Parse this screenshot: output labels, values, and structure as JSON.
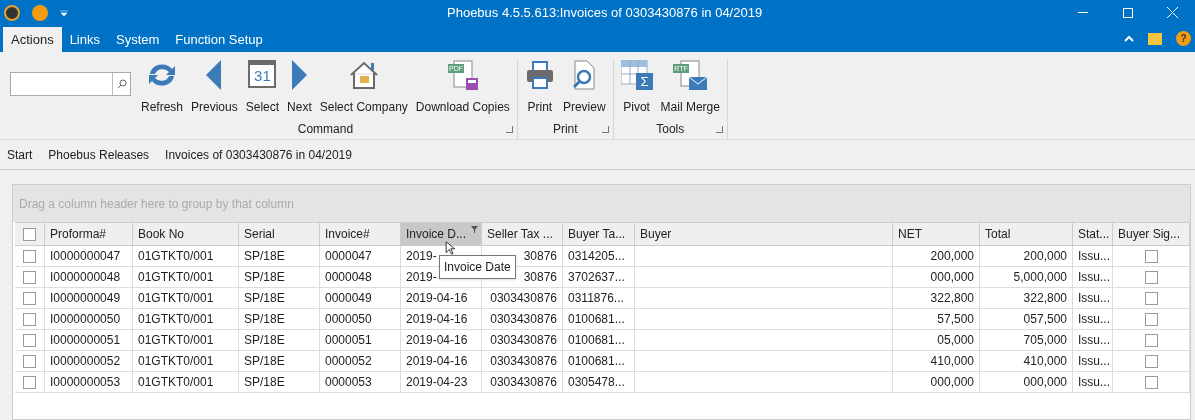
{
  "window": {
    "title": "Phoebus 4.5.5.613:Invoices of 0303430876 in 04/2019",
    "help": "?"
  },
  "menu_tabs": [
    {
      "label": "Actions",
      "selected": true
    },
    {
      "label": "Links",
      "selected": false
    },
    {
      "label": "System",
      "selected": false
    },
    {
      "label": "Function Setup",
      "selected": false
    }
  ],
  "ribbon": {
    "groups": [
      {
        "label": "Command",
        "buttons": [
          {
            "label": "Refresh",
            "kind": "refresh"
          },
          {
            "label": "Previous",
            "kind": "prev"
          },
          {
            "label": "Select",
            "kind": "calendar",
            "icon_text": "31"
          },
          {
            "label": "Next",
            "kind": "next"
          },
          {
            "label": "Select Company",
            "kind": "house"
          },
          {
            "label": "Download Copies",
            "kind": "pdf",
            "icon_text": "PDF"
          }
        ]
      },
      {
        "label": "Print",
        "buttons": [
          {
            "label": "Print",
            "kind": "printer"
          },
          {
            "label": "Preview",
            "kind": "preview"
          }
        ]
      },
      {
        "label": "Tools",
        "buttons": [
          {
            "label": "Pivot",
            "kind": "pivot",
            "icon_text": "Σ"
          },
          {
            "label": "Mail Merge",
            "kind": "rtf",
            "icon_text": "RTF"
          }
        ]
      }
    ]
  },
  "breadcrumb": [
    "Start",
    "Phoebus Releases",
    "Invoices of 0303430876 in 04/2019"
  ],
  "grid": {
    "group_panel": "Drag a column header here to group by that column",
    "select_all": {
      "checked": false
    },
    "columns": [
      {
        "label": "Proforma#",
        "kind": "text",
        "highlighted": false
      },
      {
        "label": "Book No",
        "kind": "text",
        "highlighted": false
      },
      {
        "label": "Serial",
        "kind": "text",
        "highlighted": false
      },
      {
        "label": "Invoice#",
        "kind": "text",
        "highlighted": false
      },
      {
        "label": "Invoice D...",
        "kind": "text",
        "highlighted": true
      },
      {
        "label": "Seller Tax ...",
        "kind": "right",
        "highlighted": false
      },
      {
        "label": "Buyer Ta...",
        "kind": "text",
        "highlighted": false
      },
      {
        "label": "Buyer",
        "kind": "text",
        "highlighted": false
      },
      {
        "label": "NET",
        "kind": "number",
        "highlighted": false
      },
      {
        "label": "Total",
        "kind": "number",
        "highlighted": false
      },
      {
        "label": "Stat...",
        "kind": "text",
        "highlighted": false
      },
      {
        "label": "Buyer Sig...",
        "kind": "check",
        "highlighted": false
      }
    ],
    "rows": [
      {
        "checked": false,
        "signed": false,
        "cells": [
          "I0000000047",
          "01GTKT0/001",
          "SP/18E",
          "0000047",
          "2019-",
          "30876",
          "0314205...",
          null,
          "200,000",
          "200,000",
          "Issu..."
        ]
      },
      {
        "checked": false,
        "signed": false,
        "cells": [
          "I0000000048",
          "01GTKT0/001",
          "SP/18E",
          "0000048",
          "2019-",
          "30876",
          "3702637...",
          null,
          "000,000",
          "5,000,000",
          "Issu..."
        ]
      },
      {
        "checked": false,
        "signed": false,
        "cells": [
          "I0000000049",
          "01GTKT0/001",
          "SP/18E",
          "0000049",
          "2019-04-16",
          "0303430876",
          "0311876...",
          null,
          "322,800",
          "322,800",
          "Issu..."
        ]
      },
      {
        "checked": false,
        "signed": false,
        "cells": [
          "I0000000050",
          "01GTKT0/001",
          "SP/18E",
          "0000050",
          "2019-04-16",
          "0303430876",
          "0100681...",
          null,
          "57,500",
          "057,500",
          "Issu..."
        ]
      },
      {
        "checked": false,
        "signed": false,
        "cells": [
          "I0000000051",
          "01GTKT0/001",
          "SP/18E",
          "0000051",
          "2019-04-16",
          "0303430876",
          "0100681...",
          null,
          "05,000",
          "705,000",
          "Issu..."
        ]
      },
      {
        "checked": false,
        "signed": false,
        "cells": [
          "I0000000052",
          "01GTKT0/001",
          "SP/18E",
          "0000052",
          "2019-04-16",
          "0303430876",
          "0100681...",
          null,
          "410,000",
          "410,000",
          "Issu..."
        ]
      },
      {
        "checked": false,
        "signed": false,
        "cells": [
          "I0000000053",
          "01GTKT0/001",
          "SP/18E",
          "0000053",
          "2019-04-23",
          "0303430876",
          "0305478...",
          null,
          "000,000",
          "000,000",
          "Issu..."
        ]
      }
    ],
    "tooltip": "Invoice Date"
  }
}
